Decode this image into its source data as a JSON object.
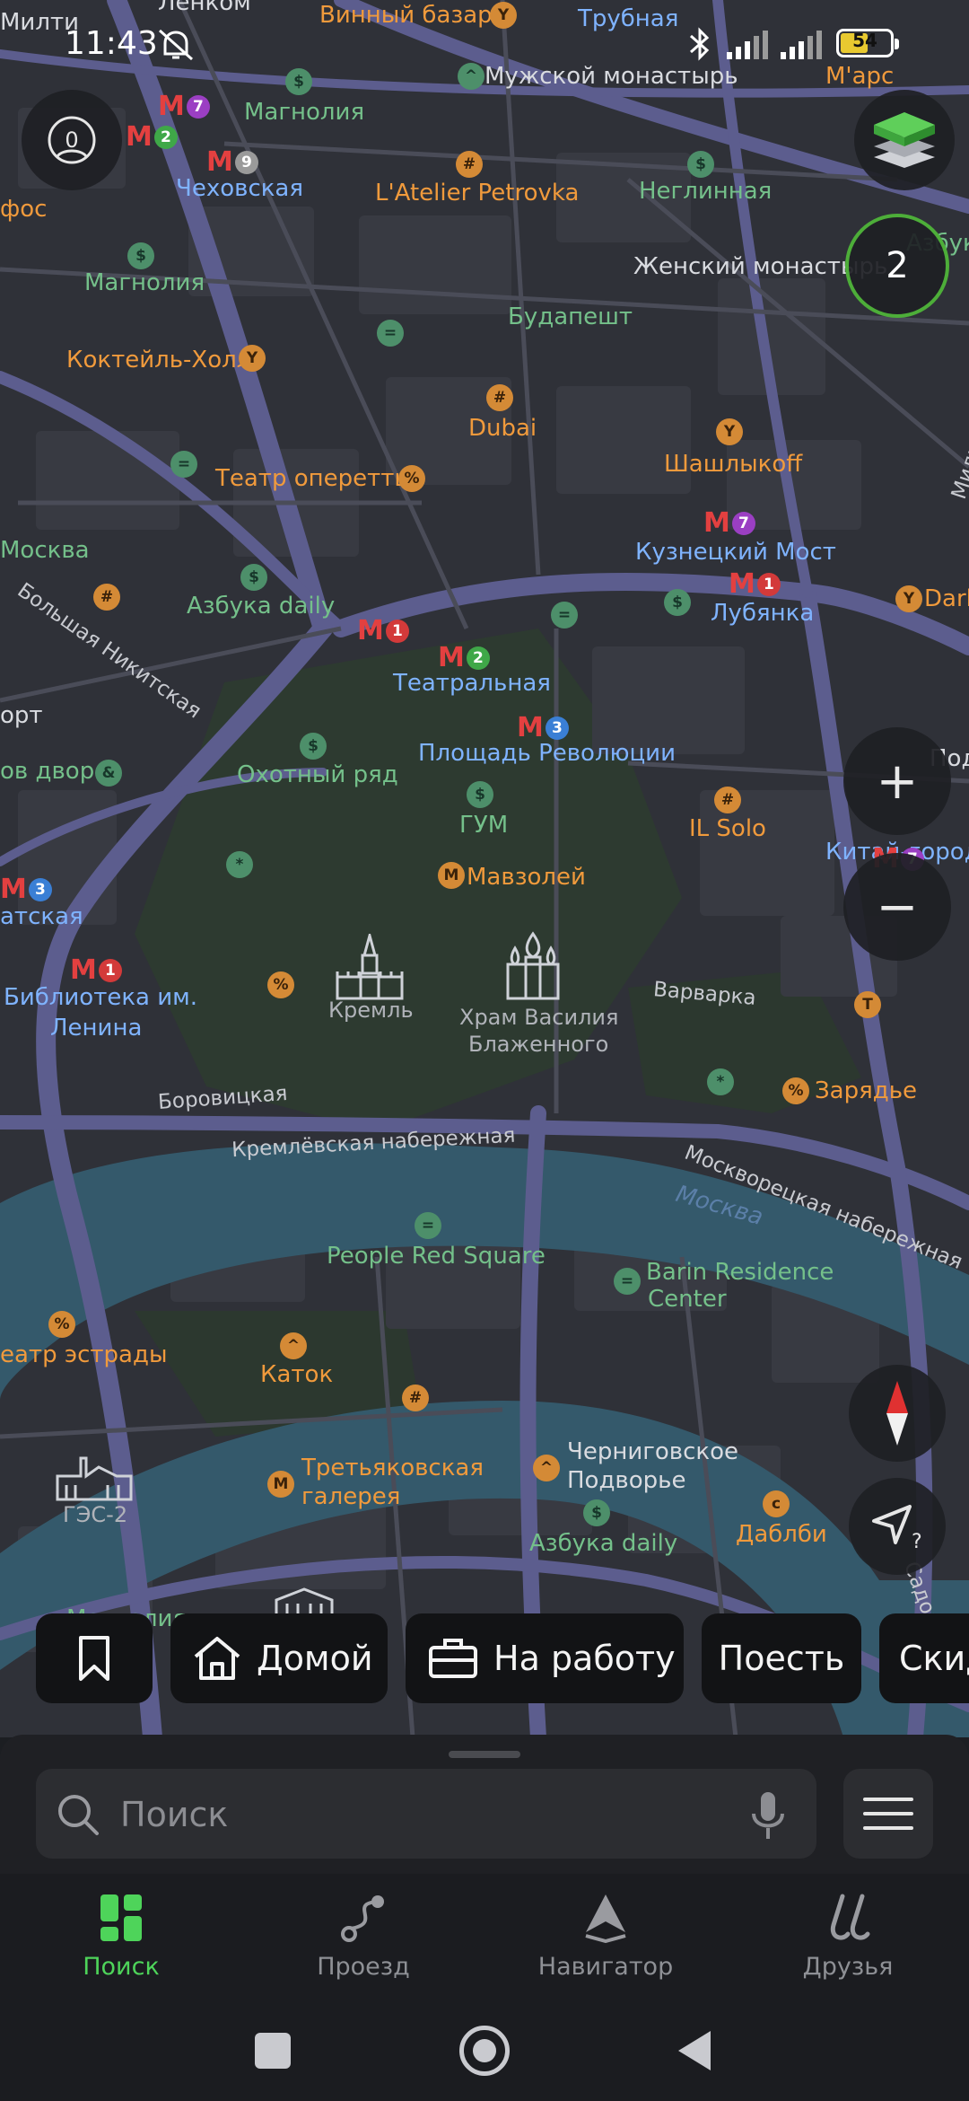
{
  "status_bar": {
    "time": "11:43",
    "battery": "54"
  },
  "map": {
    "traffic_level": "2",
    "zoom_in": "+",
    "zoom_out": "−",
    "streets": [
      "Кремлёвская набережная",
      "Москворецкая набережная",
      "Варварка",
      "Боровицкая",
      "Большая Никитская",
      "Милютинский",
      "Садов"
    ],
    "river": "Москва",
    "places": [
      {
        "text": "Винный базар",
        "style": "orange"
      },
      {
        "text": "Ленком",
        "style": "white"
      },
      {
        "text": "Трубная",
        "style": "blue"
      },
      {
        "text": "Мужской монастырь",
        "style": "white"
      },
      {
        "text": "M'арс",
        "style": "orange"
      },
      {
        "text": "Магнолия",
        "style": "green"
      },
      {
        "text": "Чеховская",
        "style": "blue"
      },
      {
        "text": "L'Atelier Petrovka",
        "style": "orange"
      },
      {
        "text": "Неглинная",
        "style": "green"
      },
      {
        "text": "Азбука",
        "style": "green"
      },
      {
        "text": "Женский монастырь",
        "style": "white"
      },
      {
        "text": "Магнолия",
        "style": "green"
      },
      {
        "text": "Будапешт",
        "style": "green"
      },
      {
        "text": "Коктейль-Холл",
        "style": "orange"
      },
      {
        "text": "Dubai",
        "style": "orange"
      },
      {
        "text": "Шашлыкоff",
        "style": "orange"
      },
      {
        "text": "Театр оперетты",
        "style": "orange"
      },
      {
        "text": "Кузнецкий Мост",
        "style": "blue"
      },
      {
        "text": "Москва",
        "style": "green"
      },
      {
        "text": "Лубянка",
        "style": "blue"
      },
      {
        "text": "Азбука daily",
        "style": "green"
      },
      {
        "text": "Dark",
        "style": "orange"
      },
      {
        "text": "Театральная",
        "style": "blue"
      },
      {
        "text": "Охотный ряд",
        "style": "green"
      },
      {
        "text": "Площадь Революции",
        "style": "blue"
      },
      {
        "text": "ГУМ",
        "style": "green"
      },
      {
        "text": "IL Solo",
        "style": "orange"
      },
      {
        "text": "Мавзолей",
        "style": "orange"
      },
      {
        "text": "Китай-город",
        "style": "blue"
      },
      {
        "text": "Библиотека им.",
        "style": "blue"
      },
      {
        "text": "Ленина",
        "style": "blue"
      },
      {
        "text": "Кремль",
        "style": "gray"
      },
      {
        "text": "Храм Василия",
        "style": "gray"
      },
      {
        "text": "Блаженного",
        "style": "gray"
      },
      {
        "text": "Зарядье",
        "style": "orange"
      },
      {
        "text": "People Red Square",
        "style": "green"
      },
      {
        "text": "Barin Residence",
        "style": "green"
      },
      {
        "text": "Center",
        "style": "green"
      },
      {
        "text": "еатр эстрады",
        "style": "orange"
      },
      {
        "text": "Каток",
        "style": "orange"
      },
      {
        "text": "Третьяковская",
        "style": "orange"
      },
      {
        "text": "галерея",
        "style": "orange"
      },
      {
        "text": "Черниговское",
        "style": "white"
      },
      {
        "text": "Подворье",
        "style": "white"
      },
      {
        "text": "Азбука daily",
        "style": "green"
      },
      {
        "text": "Даблби",
        "style": "orange"
      },
      {
        "text": "ГЭС-2",
        "style": "gray"
      },
      {
        "text": "Милти",
        "style": "white"
      },
      {
        "text": "фос",
        "style": "orange"
      },
      {
        "text": "орт",
        "style": "white"
      },
      {
        "text": "ов двор",
        "style": "green"
      },
      {
        "text": "атская",
        "style": "blue"
      },
      {
        "text": "Под",
        "style": "white"
      },
      {
        "text": "Магнолия",
        "style": "green"
      }
    ]
  },
  "chips": {
    "home": "Домой",
    "work": "На работу",
    "eat": "Поесть",
    "discounts": "Скид"
  },
  "search": {
    "placeholder": "Поиск"
  },
  "tabs": {
    "search": "Поиск",
    "route": "Проезд",
    "navigator": "Навигатор",
    "friends": "Друзья"
  },
  "colors": {
    "accent": "#4ed45a",
    "map_bg": "#2f3138",
    "road": "#5a5a8a",
    "river": "#34596b",
    "metro": "#e34040"
  }
}
